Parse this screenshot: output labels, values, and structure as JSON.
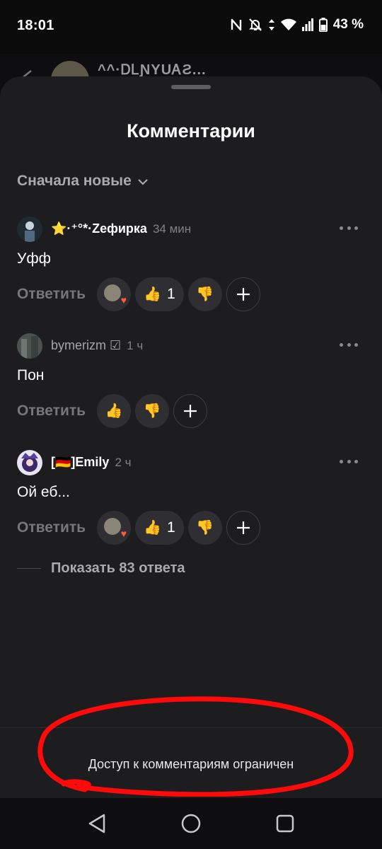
{
  "status_bar": {
    "time": "18:01",
    "battery": "43 %"
  },
  "behind": {
    "title": "^^·ᎠᏞƝYUᎪƧ..."
  },
  "sheet": {
    "title": "Комментарии",
    "sort_label": "Сначала новые"
  },
  "comments": [
    {
      "author": "⭐·⁺°*·Zeфирка",
      "time": "34 мин",
      "text": "Уфф",
      "reply_label": "Ответить",
      "like_count": "1"
    },
    {
      "author": "bymerizm ☑",
      "time": "1 ч",
      "text": "Пон",
      "reply_label": "Ответить"
    },
    {
      "author": "[🇩🇪]Emily",
      "time": "2 ч",
      "text": "Ой еб...",
      "reply_label": "Ответить",
      "like_count": "1"
    }
  ],
  "show_replies": "Показать 83 ответа",
  "restricted_notice": "Доступ к комментариям ограничен",
  "icons": {
    "nfc": "nfc-icon",
    "mute": "bell-off-icon",
    "wifi": "wifi-icon",
    "signal": "signal-icon",
    "battery": "battery-icon",
    "back": "back-arrow-icon",
    "more": "more-dots-icon",
    "like": "thumbs-up-icon",
    "dislike": "thumbs-down-icon",
    "add": "plus-icon"
  },
  "colors": {
    "sheet_bg": "#1d1d20",
    "pill_bg": "#2f2f33",
    "annotation": "#ff0000"
  }
}
